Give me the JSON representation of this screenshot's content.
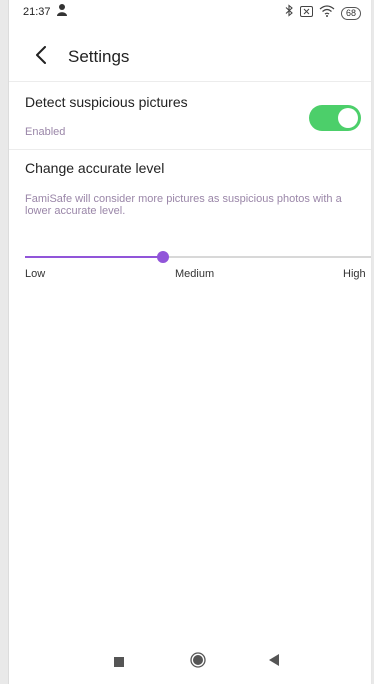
{
  "status_bar": {
    "time": "21:37",
    "battery": "68",
    "icons": [
      "person-icon",
      "bluetooth-icon",
      "sim-icon",
      "wifi-icon",
      "battery-icon"
    ]
  },
  "header": {
    "title": "Settings"
  },
  "detect": {
    "title": "Detect suspicious pictures",
    "status": "Enabled",
    "enabled": true,
    "toggle_color": "#4ccf6a"
  },
  "accuracy": {
    "title": "Change accurate level",
    "description": "FamiSafe will consider more pictures as suspicious photos with a lower accurate level.",
    "levels": [
      "Low",
      "Medium",
      "High"
    ],
    "selected_level": "Medium",
    "slider_position": 0.4,
    "accent_color": "#9155d9"
  },
  "nav_bar": {
    "buttons": [
      "recents-square-icon",
      "home-circle-icon",
      "back-triangle-icon"
    ]
  }
}
